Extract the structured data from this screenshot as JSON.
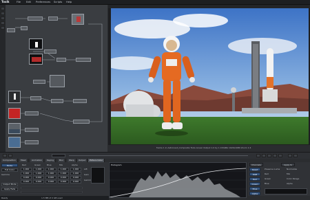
{
  "menubar": {
    "logo": "Toxik",
    "items": [
      "File",
      "Edit",
      "Preferences",
      "Scripts",
      "Help"
    ]
  },
  "nodegraph": {
    "nodes": [
      "",
      "",
      "",
      "",
      "",
      "",
      "",
      "",
      "",
      "",
      "",
      "",
      "",
      "",
      ""
    ]
  },
  "viewer": {
    "status_text": "frame 1 in Astronaut_Composite   Tools Linear Output  1.0 by 1.0  RGBA  1920x1080  Zoom 1:4"
  },
  "timeline": {
    "frame_field": "1"
  },
  "bottom": {
    "tabs": [
      "Composition",
      "Mask",
      "Animation",
      "Keying",
      "Blur",
      "Warp",
      "Output",
      "Picture Color"
    ],
    "left_panel": {
      "header": "Mode",
      "mode_value": "Full Color",
      "labels": [
        "Gamma",
        "Output Mode",
        "Apply Fade"
      ],
      "columns": [
        "Red",
        "Green",
        "Blue",
        "Mix",
        "Alpha"
      ],
      "rows": [
        [
          "1.000",
          "1.000",
          "1.000",
          "1.000",
          "1.000"
        ],
        [
          "1.000",
          "1.000",
          "1.000",
          "1.000",
          "1.000"
        ],
        [
          "0.000",
          "0.000",
          "0.000",
          "0.000",
          "0.000"
        ],
        [
          "0.000",
          "0.000",
          "0.000",
          "0.000",
          "0.000"
        ]
      ],
      "side_labels": [
        "Lift",
        "Gain",
        "Gamma"
      ]
    },
    "histogram_label": "Histogram",
    "right_panel": {
      "top_buttons": [
        "Channels",
        "Apply to"
      ],
      "buttons": [
        "Reset",
        "RGB",
        "Red",
        "Green",
        "Blue",
        "Alpha"
      ],
      "options": [
        "Preserve Luma",
        "Normalize"
      ],
      "labels": [
        "Red",
        "Green",
        "Blue",
        "Mix",
        "Color Range",
        "Alpha"
      ]
    },
    "status": {
      "left": "Ready",
      "memory": "1.5 MB of 2 GB used"
    }
  },
  "colors": {
    "accent": "#35557f",
    "node_bg": "#3a3d41",
    "viewer_bg": "#1e1f21"
  }
}
